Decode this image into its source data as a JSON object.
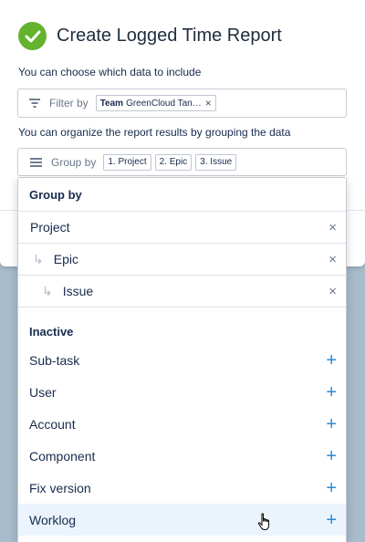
{
  "dialog": {
    "title": "Create Logged Time Report",
    "filter_hint": "You can choose which data to include",
    "filter_label": "Filter by",
    "filter_chip_key": "Team",
    "filter_chip_value": "GreenCloud Tan…",
    "group_hint": "You can organize the report results by grouping the data",
    "group_label": "Group by",
    "group_chips": [
      "1. Project",
      "2. Epic",
      "3. Issue"
    ]
  },
  "dropdown": {
    "header": "Group by",
    "selected": [
      "Project",
      "Epic",
      "Issue"
    ],
    "inactive_header": "Inactive",
    "inactive_items": [
      "Sub-task",
      "User",
      "Account",
      "Component",
      "Fix version",
      "Worklog"
    ]
  },
  "colors": {
    "success": "#63b32e",
    "accent": "#2a8bd5",
    "hover_row": "#ebf4fc"
  },
  "icons": {
    "success": "check-circle-icon",
    "filter": "filter-icon",
    "group": "menu-icon",
    "remove": "close-icon",
    "add": "plus-icon",
    "sub": "sub-arrow-icon",
    "cursor": "hand-pointer-icon"
  }
}
